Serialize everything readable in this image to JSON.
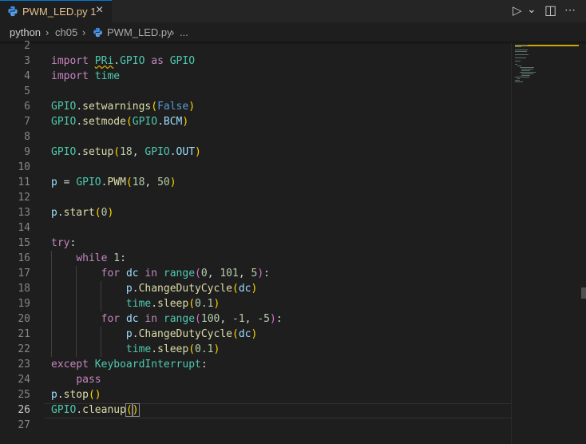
{
  "tab": {
    "filename": "PWM_LED.py",
    "problem_count": "1",
    "close": "×"
  },
  "actions": {
    "run": "▷",
    "run_dropdown": "⌄",
    "split": "◫",
    "more": "⋯"
  },
  "breadcrumb": {
    "root": "python",
    "sep1": "›",
    "folder": "ch05",
    "sep2": "›",
    "file": "PWM_LED.py",
    "sep3": "›",
    "more": "..."
  },
  "gutter": [
    "2",
    "3",
    "4",
    "5",
    "6",
    "7",
    "8",
    "9",
    "10",
    "11",
    "12",
    "13",
    "14",
    "15",
    "16",
    "17",
    "18",
    "19",
    "20",
    "21",
    "22",
    "23",
    "24",
    "25",
    "26",
    "27"
  ],
  "current_line": "26",
  "lines": [
    [],
    [
      {
        "t": "import ",
        "c": "kw"
      },
      {
        "t": "PRi",
        "c": "cls squig"
      },
      {
        "t": ".",
        "c": ""
      },
      {
        "t": "GPIO",
        "c": "cls"
      },
      {
        "t": " as ",
        "c": "kw"
      },
      {
        "t": "GPIO",
        "c": "cls"
      }
    ],
    [
      {
        "t": "import ",
        "c": "kw"
      },
      {
        "t": "time",
        "c": "cls"
      }
    ],
    [],
    [
      {
        "t": "GPIO",
        "c": "cls"
      },
      {
        "t": ".",
        "c": ""
      },
      {
        "t": "setwarnings",
        "c": "fn"
      },
      {
        "t": "(",
        "c": "b1"
      },
      {
        "t": "False",
        "c": "const"
      },
      {
        "t": ")",
        "c": "b1"
      }
    ],
    [
      {
        "t": "GPIO",
        "c": "cls"
      },
      {
        "t": ".",
        "c": ""
      },
      {
        "t": "setmode",
        "c": "fn"
      },
      {
        "t": "(",
        "c": "b1"
      },
      {
        "t": "GPIO",
        "c": "cls"
      },
      {
        "t": ".BCM",
        "c": "var"
      },
      {
        "t": ")",
        "c": "b1"
      }
    ],
    [],
    [
      {
        "t": "GPIO",
        "c": "cls"
      },
      {
        "t": ".",
        "c": ""
      },
      {
        "t": "setup",
        "c": "fn"
      },
      {
        "t": "(",
        "c": "b1"
      },
      {
        "t": "18",
        "c": "num"
      },
      {
        "t": ", ",
        "c": ""
      },
      {
        "t": "GPIO",
        "c": "cls"
      },
      {
        "t": ".OUT",
        "c": "var"
      },
      {
        "t": ")",
        "c": "b1"
      }
    ],
    [],
    [
      {
        "t": "p",
        "c": "var"
      },
      {
        "t": " = ",
        "c": ""
      },
      {
        "t": "GPIO",
        "c": "cls"
      },
      {
        "t": ".",
        "c": ""
      },
      {
        "t": "PWM",
        "c": "fn"
      },
      {
        "t": "(",
        "c": "b1"
      },
      {
        "t": "18",
        "c": "num"
      },
      {
        "t": ", ",
        "c": ""
      },
      {
        "t": "50",
        "c": "num"
      },
      {
        "t": ")",
        "c": "b1"
      }
    ],
    [],
    [
      {
        "t": "p",
        "c": "var"
      },
      {
        "t": ".",
        "c": ""
      },
      {
        "t": "start",
        "c": "fn"
      },
      {
        "t": "(",
        "c": "b1"
      },
      {
        "t": "0",
        "c": "num"
      },
      {
        "t": ")",
        "c": "b1"
      }
    ],
    [],
    [
      {
        "t": "try",
        "c": "kw"
      },
      {
        "t": ":",
        "c": ""
      }
    ],
    [
      {
        "t": "    ",
        "c": ""
      },
      {
        "t": "while ",
        "c": "kw"
      },
      {
        "t": "1",
        "c": "num"
      },
      {
        "t": ":",
        "c": ""
      }
    ],
    [
      {
        "t": "        ",
        "c": ""
      },
      {
        "t": "for ",
        "c": "kw"
      },
      {
        "t": "dc",
        "c": "var"
      },
      {
        "t": " in ",
        "c": "kw"
      },
      {
        "t": "range",
        "c": "cls"
      },
      {
        "t": "(",
        "c": "b2"
      },
      {
        "t": "0",
        "c": "num"
      },
      {
        "t": ", ",
        "c": ""
      },
      {
        "t": "101",
        "c": "num"
      },
      {
        "t": ", ",
        "c": ""
      },
      {
        "t": "5",
        "c": "num"
      },
      {
        "t": ")",
        "c": "b2"
      },
      {
        "t": ":",
        "c": ""
      }
    ],
    [
      {
        "t": "            ",
        "c": ""
      },
      {
        "t": "p",
        "c": "var"
      },
      {
        "t": ".",
        "c": ""
      },
      {
        "t": "ChangeDutyCycle",
        "c": "fn"
      },
      {
        "t": "(",
        "c": "b1"
      },
      {
        "t": "dc",
        "c": "var"
      },
      {
        "t": ")",
        "c": "b1"
      }
    ],
    [
      {
        "t": "            ",
        "c": ""
      },
      {
        "t": "time",
        "c": "cls"
      },
      {
        "t": ".",
        "c": ""
      },
      {
        "t": "sleep",
        "c": "fn"
      },
      {
        "t": "(",
        "c": "b1"
      },
      {
        "t": "0.1",
        "c": "num"
      },
      {
        "t": ")",
        "c": "b1"
      }
    ],
    [
      {
        "t": "        ",
        "c": ""
      },
      {
        "t": "for ",
        "c": "kw"
      },
      {
        "t": "dc",
        "c": "var"
      },
      {
        "t": " in ",
        "c": "kw"
      },
      {
        "t": "range",
        "c": "cls"
      },
      {
        "t": "(",
        "c": "b2"
      },
      {
        "t": "100",
        "c": "num"
      },
      {
        "t": ", ",
        "c": ""
      },
      {
        "t": "-1",
        "c": "num"
      },
      {
        "t": ", ",
        "c": ""
      },
      {
        "t": "-5",
        "c": "num"
      },
      {
        "t": ")",
        "c": "b2"
      },
      {
        "t": ":",
        "c": ""
      }
    ],
    [
      {
        "t": "            ",
        "c": ""
      },
      {
        "t": "p",
        "c": "var"
      },
      {
        "t": ".",
        "c": ""
      },
      {
        "t": "ChangeDutyCycle",
        "c": "fn"
      },
      {
        "t": "(",
        "c": "b1"
      },
      {
        "t": "dc",
        "c": "var"
      },
      {
        "t": ")",
        "c": "b1"
      }
    ],
    [
      {
        "t": "            ",
        "c": ""
      },
      {
        "t": "time",
        "c": "cls"
      },
      {
        "t": ".",
        "c": ""
      },
      {
        "t": "sleep",
        "c": "fn"
      },
      {
        "t": "(",
        "c": "b1"
      },
      {
        "t": "0.1",
        "c": "num"
      },
      {
        "t": ")",
        "c": "b1"
      }
    ],
    [
      {
        "t": "except ",
        "c": "kw"
      },
      {
        "t": "KeyboardInterrupt",
        "c": "cls"
      },
      {
        "t": ":",
        "c": ""
      }
    ],
    [
      {
        "t": "    ",
        "c": ""
      },
      {
        "t": "pass",
        "c": "kw"
      }
    ],
    [
      {
        "t": "p",
        "c": "var"
      },
      {
        "t": ".",
        "c": ""
      },
      {
        "t": "stop",
        "c": "fn"
      },
      {
        "t": "()",
        "c": "b1"
      }
    ],
    [
      {
        "t": "GPIO",
        "c": "cls"
      },
      {
        "t": ".",
        "c": ""
      },
      {
        "t": "cleanup",
        "c": "fn"
      },
      {
        "t": "(",
        "c": "b1 bmatch"
      },
      {
        "t": ")",
        "c": "b1 bmatch"
      }
    ],
    []
  ],
  "colors": {
    "background": "#1e1e1e",
    "keyword": "#c586c0",
    "class": "#4ec9b0",
    "number": "#b5cea8",
    "function": "#dcdcaa",
    "warning": "#cca700",
    "modified_tab": "#e2c08d"
  }
}
